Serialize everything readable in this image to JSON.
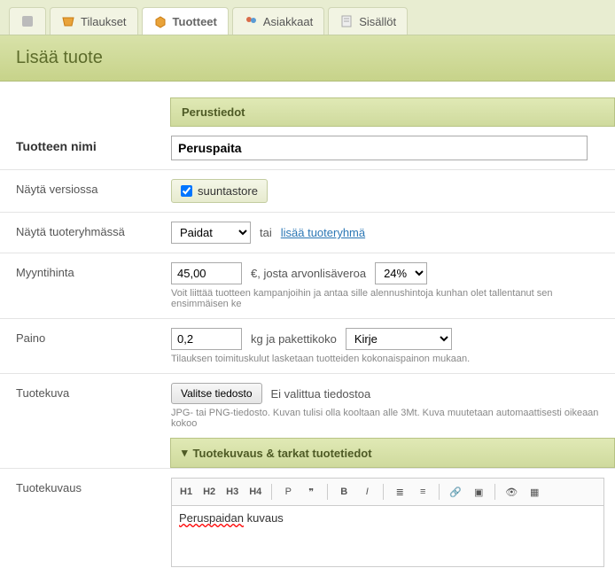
{
  "tabs": {
    "orders": "Tilaukset",
    "products": "Tuotteet",
    "customers": "Asiakkaat",
    "content": "Sisällöt"
  },
  "page_title": "Lisää tuote",
  "sections": {
    "basic": "Perustiedot",
    "desc": "Tuotekuvaus & tarkat tuotetiedot"
  },
  "labels": {
    "product_name": "Tuotteen nimi",
    "show_in_version": "Näytä versiossa",
    "show_in_group": "Näytä tuoteryhmässä",
    "sale_price": "Myyntihinta",
    "weight": "Paino",
    "product_image": "Tuotekuva",
    "description": "Tuotekuvaus"
  },
  "values": {
    "product_name": "Peruspaita",
    "version_checkbox_label": "suuntastore",
    "version_checked": true,
    "group_select": "Paidat",
    "group_or_text": "tai",
    "group_add_link": "lisää tuoteryhmä",
    "price": "45,00",
    "price_unit": "€, josta arvonlisäveroa",
    "vat": "24%",
    "price_hint": "Voit liittää tuotteen kampanjoihin ja antaa sille alennushintoja kunhan olet tallentanut sen ensimmäisen ke",
    "weight": "0,2",
    "weight_unit": "kg ja pakettikoko",
    "package": "Kirje",
    "weight_hint": "Tilauksen toimituskulut lasketaan tuotteiden kokonaispainon mukaan.",
    "file_btn": "Valitse tiedosto",
    "file_status": "Ei valittua tiedostoa",
    "file_hint": "JPG- tai PNG-tiedosto. Kuvan tulisi olla kooltaan alle 3Mt. Kuva muutetaan automaattisesti oikeaan kokoo",
    "editor_content_prefix": "Peruspaidan",
    "editor_content_suffix": " kuvaus"
  },
  "toolbar": {
    "h1": "H1",
    "h2": "H2",
    "h3": "H3",
    "h4": "H4",
    "p": "P",
    "quote": "❞",
    "bold": "B",
    "italic": "I",
    "ul": "≣",
    "ol": "≡",
    "link": "🔗",
    "img": "▣",
    "eye": "👁",
    "grid": "▦"
  }
}
